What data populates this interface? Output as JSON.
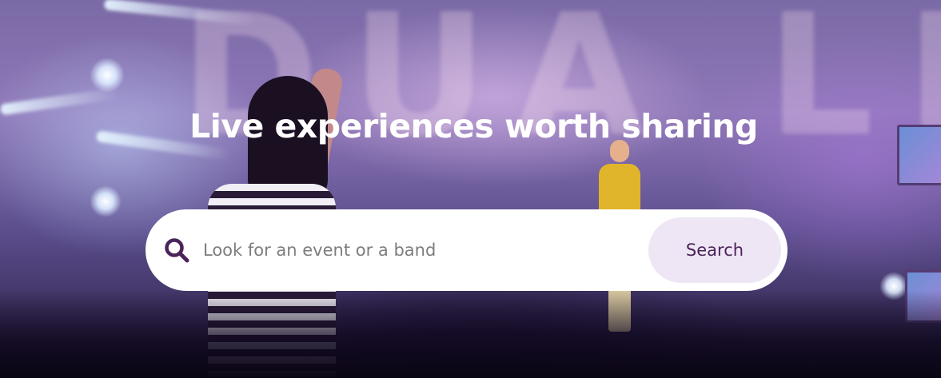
{
  "hero": {
    "headline": "Live experiences worth sharing",
    "backdrop_sign": "DUA LIPA",
    "overlay_color": "#6a4f9e",
    "search": {
      "placeholder": "Look for an event or a band",
      "value": "",
      "button_label": "Search",
      "icon": "search-icon",
      "icon_color": "#4a2358",
      "button_bg": "#efe6f5",
      "button_text_color": "#4a2358"
    }
  }
}
